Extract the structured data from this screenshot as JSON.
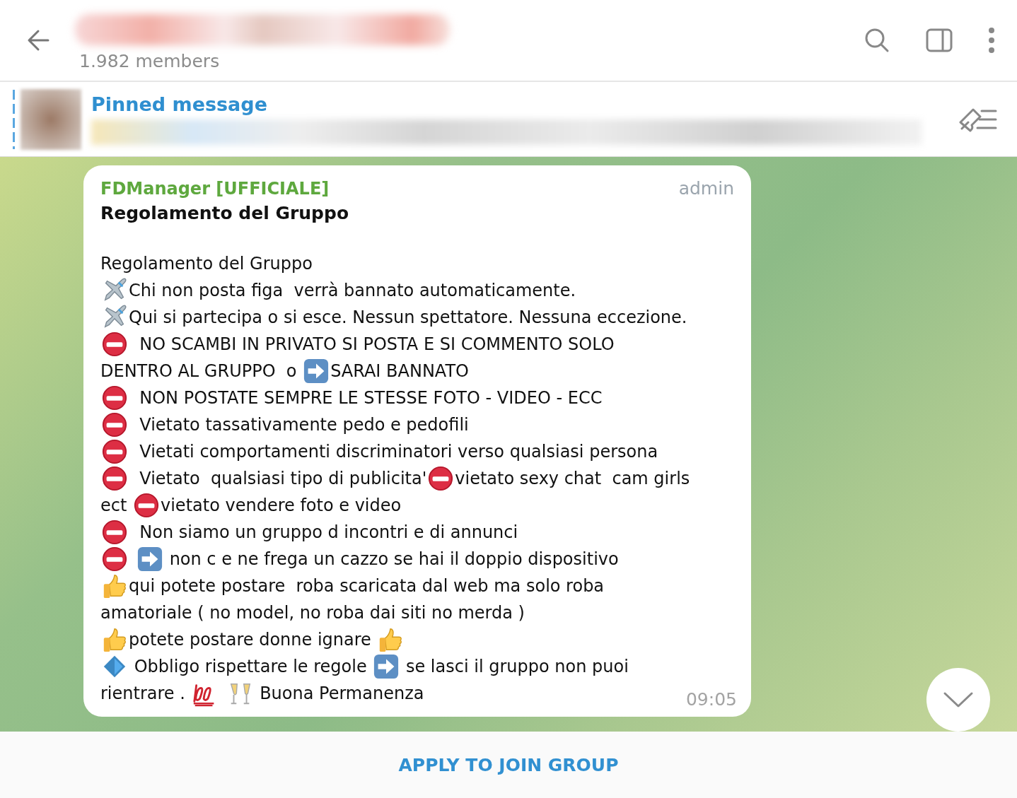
{
  "header": {
    "subtitle": "1.982 members"
  },
  "pinned": {
    "title": "Pinned message"
  },
  "message": {
    "sender": "FDManager [UFFICIALE]",
    "badge": "admin",
    "title": "Regolamento del Gruppo",
    "time": "09:05",
    "lines": [
      [
        "Regolamento del Gruppo"
      ],
      [
        {
          "kind": "plane"
        },
        "Chi non posta figa  verrà bannato automaticamente."
      ],
      [
        {
          "kind": "plane"
        },
        "Qui si partecipa o si esce. Nessun spettatore. Nessuna eccezione."
      ],
      [
        {
          "kind": "noentry"
        },
        "  NO SCAMBI IN PRIVATO SI POSTA E SI COMMENTO SOLO"
      ],
      [
        "DENTRO AL GRUPPO  o ",
        {
          "kind": "arrow"
        },
        "SARAI BANNATO"
      ],
      [
        {
          "kind": "noentry"
        },
        "  NON POSTATE SEMPRE LE STESSE FOTO - VIDEO - ECC"
      ],
      [
        {
          "kind": "noentry"
        },
        "  Vietato tassativamente pedo e pedofili"
      ],
      [
        {
          "kind": "noentry"
        },
        "  Vietati comportamenti discriminatori verso qualsiasi persona"
      ],
      [
        {
          "kind": "noentry"
        },
        "  Vietato  qualsiasi tipo di publicita'",
        {
          "kind": "noentry"
        },
        "vietato sexy chat  cam girls"
      ],
      [
        "ect ",
        {
          "kind": "noentry"
        },
        "vietato vendere foto e video"
      ],
      [
        {
          "kind": "noentry"
        },
        "  Non siamo un gruppo d incontri e di annunci"
      ],
      [
        {
          "kind": "noentry"
        },
        {
          "kind": "arrow"
        },
        " non c e ne frega un cazzo se hai il doppio dispositivo"
      ],
      [
        {
          "kind": "thumb"
        },
        "qui potete postare  roba scaricata dal web ma solo roba"
      ],
      [
        "amatoriale ( no model, no roba dai siti no merda )"
      ],
      [
        {
          "kind": "thumb"
        },
        "potete postare donne ignare ",
        {
          "kind": "thumb"
        }
      ],
      [
        {
          "kind": "diamond"
        },
        " Obbligo rispettare le regole ",
        {
          "kind": "arrow"
        },
        " se lasci il gruppo non puoi"
      ],
      [
        "rientrare . ",
        {
          "kind": "hundred"
        },
        {
          "kind": "glasses"
        },
        " Buona Permanenza"
      ]
    ]
  },
  "footer": {
    "button": "APPLY TO JOIN GROUP"
  }
}
